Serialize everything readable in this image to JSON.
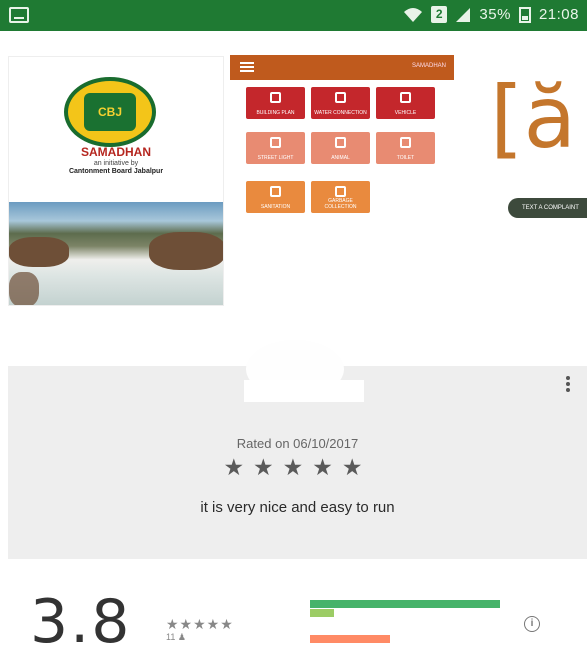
{
  "status_bar": {
    "sim_label": "2",
    "battery": "35%",
    "time": "21:08",
    "bg_color": "#1f7a33"
  },
  "screenshots": {
    "first": {
      "emblem_text": "CBJ",
      "app_name": "SAMADHAN",
      "tagline": "an initiative by",
      "org": "Cantonment Board Jabalpur"
    },
    "second": {
      "bar_title": "SAMADHAN",
      "tiles": [
        {
          "label": "BUILDING PLAN",
          "color": "red",
          "icon": "drum-icon"
        },
        {
          "label": "WATER CONNECTION",
          "color": "red",
          "icon": "tap-icon"
        },
        {
          "label": "VEHICLE",
          "color": "red",
          "icon": "car-icon"
        },
        {
          "label": "STREET LIGHT",
          "color": "salmon",
          "icon": "lamp-icon"
        },
        {
          "label": "ANIMAL",
          "color": "salmon",
          "icon": "cow-icon"
        },
        {
          "label": "TOILET",
          "color": "salmon",
          "icon": "toilet-icon"
        },
        {
          "label": "SANITATION",
          "color": "orange",
          "icon": "sweep-icon"
        },
        {
          "label": "GARBAGE COLLECTION",
          "color": "orange",
          "icon": "bin-icon"
        }
      ]
    },
    "third": {
      "pill_text": "TEXT A COMPLAINT"
    }
  },
  "review": {
    "rated_on": "Rated on 06/10/2017",
    "stars": "★★★★★",
    "star_value": 5,
    "text": "it is very nice and easy to run"
  },
  "summary": {
    "score": "3.8",
    "mini_stars": "★★★★★",
    "reviews_count": "11 ♟",
    "bars": [
      {
        "color": "#46b36a",
        "fraction": 0.95
      },
      {
        "color": "#9ccc65",
        "fraction": 0.12
      },
      {
        "color": "#ff8a65",
        "fraction": 0.4
      }
    ]
  }
}
